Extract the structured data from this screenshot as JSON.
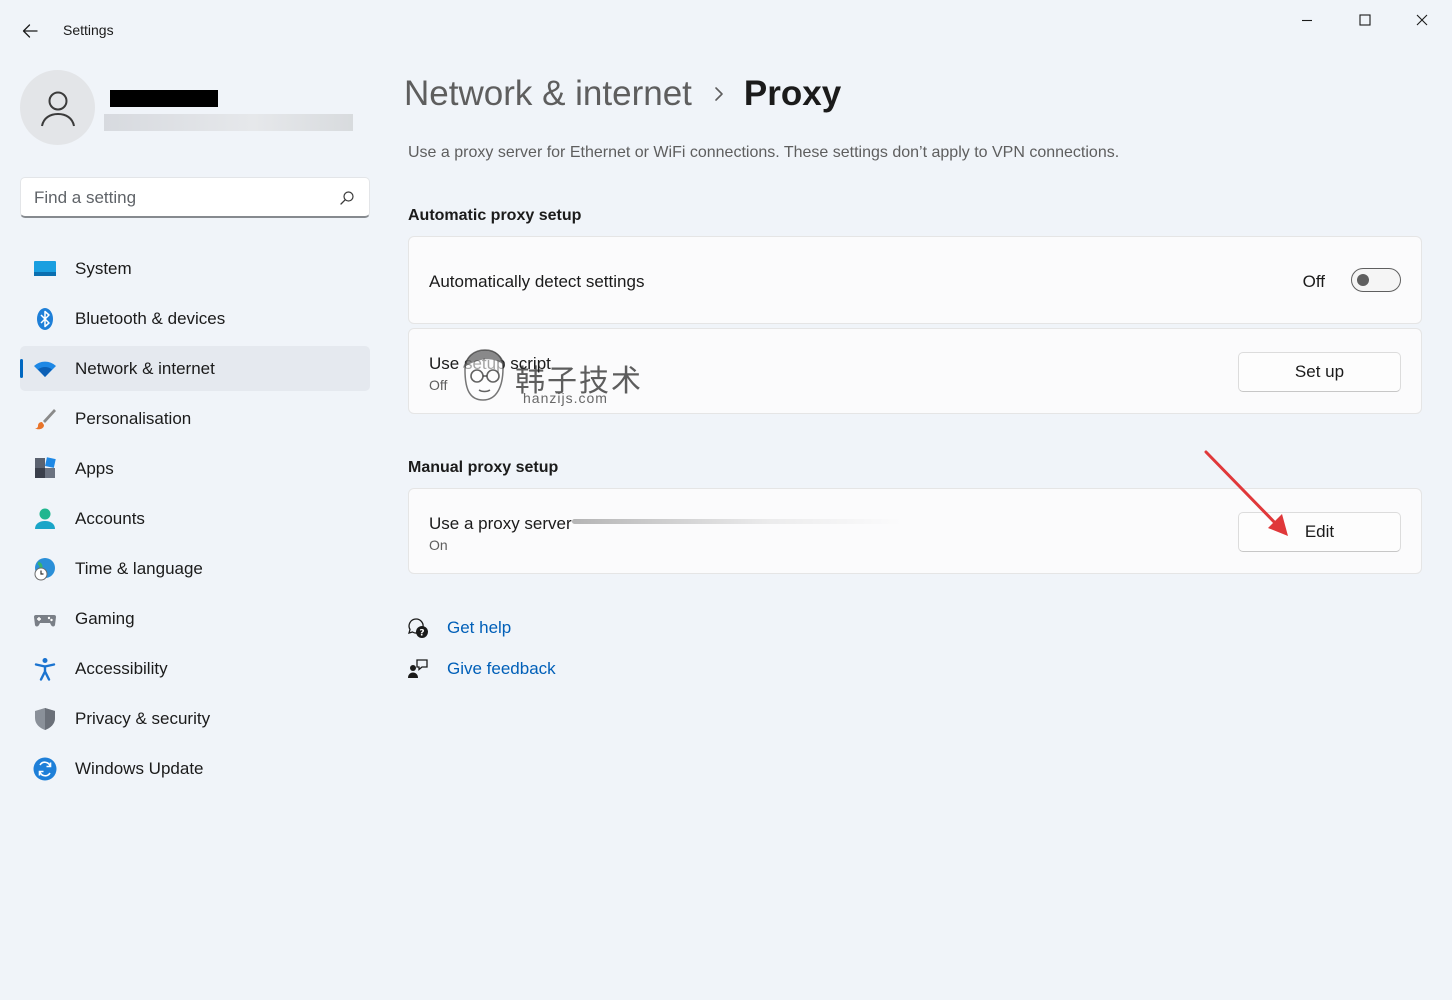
{
  "window": {
    "title": "Settings"
  },
  "search": {
    "placeholder": "Find a setting"
  },
  "nav": {
    "items": [
      {
        "label": "System"
      },
      {
        "label": "Bluetooth & devices"
      },
      {
        "label": "Network & internet"
      },
      {
        "label": "Personalisation"
      },
      {
        "label": "Apps"
      },
      {
        "label": "Accounts"
      },
      {
        "label": "Time & language"
      },
      {
        "label": "Gaming"
      },
      {
        "label": "Accessibility"
      },
      {
        "label": "Privacy & security"
      },
      {
        "label": "Windows Update"
      }
    ],
    "active_index": 2
  },
  "breadcrumb": {
    "parent": "Network & internet",
    "current": "Proxy"
  },
  "description": "Use a proxy server for Ethernet or WiFi connections. These settings don’t apply to VPN connections.",
  "automatic": {
    "section_title": "Automatic proxy setup",
    "detect": {
      "label": "Automatically detect settings",
      "state": "Off",
      "on": false
    },
    "script": {
      "label": "Use setup script",
      "status": "Off",
      "button": "Set up"
    }
  },
  "manual": {
    "section_title": "Manual proxy setup",
    "proxy": {
      "label": "Use a proxy server",
      "status": "On",
      "button": "Edit"
    }
  },
  "links": {
    "help": "Get help",
    "feedback": "Give feedback"
  },
  "watermark": {
    "text": "韩子技术",
    "sub": "hanzijs.com"
  },
  "colors": {
    "accent": "#0067c0",
    "link": "#005fb8",
    "annotation_arrow": "#e0383a"
  }
}
